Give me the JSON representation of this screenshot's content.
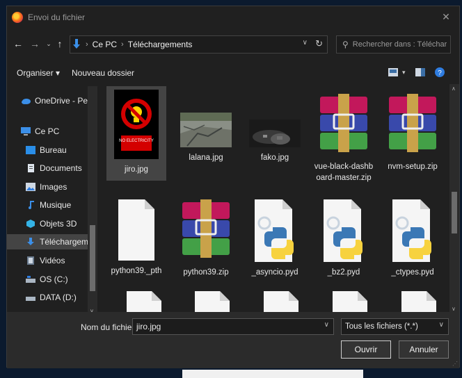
{
  "window": {
    "title": "Envoi du fichier",
    "close_glyph": "✕"
  },
  "nav": {
    "breadcrumbs": [
      "Ce PC",
      "Téléchargements"
    ],
    "search_placeholder": "Rechercher dans : Télécharg..."
  },
  "toolbar": {
    "organize": "Organiser ▾",
    "new_folder": "Nouveau dossier"
  },
  "sidebar": {
    "items": [
      {
        "label": "OneDrive - Persor",
        "icon": "cloud-icon"
      },
      {
        "label": "Ce PC",
        "icon": "computer-icon"
      },
      {
        "label": "Bureau",
        "icon": "desktop-icon"
      },
      {
        "label": "Documents",
        "icon": "documents-icon"
      },
      {
        "label": "Images",
        "icon": "pictures-icon"
      },
      {
        "label": "Musique",
        "icon": "music-icon"
      },
      {
        "label": "Objets 3D",
        "icon": "3d-objects-icon"
      },
      {
        "label": "Téléchargements",
        "icon": "downloads-icon",
        "selected": true
      },
      {
        "label": "Vidéos",
        "icon": "videos-icon"
      },
      {
        "label": "OS (C:)",
        "icon": "drive-icon"
      },
      {
        "label": "DATA (D:)",
        "icon": "drive-icon"
      }
    ]
  },
  "files": [
    {
      "name": "jiro.jpg",
      "type": "no-electricity-image",
      "selected": true,
      "sign_text": "NO ELECTRICITY"
    },
    {
      "name": "lalana.jpg",
      "type": "road-image"
    },
    {
      "name": "fako.jpg",
      "type": "trash-image"
    },
    {
      "name": "vue-black-dashboard-master.zip",
      "line1": "vue-black-dashb",
      "line2": "oard-master.zip",
      "type": "winrar-archive"
    },
    {
      "name": "nvm-setup.zip",
      "type": "winrar-archive"
    },
    {
      "name": "python39._pth",
      "type": "blank-file"
    },
    {
      "name": "python39.zip",
      "type": "winrar-archive"
    },
    {
      "name": "_asyncio.pyd",
      "type": "python-file"
    },
    {
      "name": "_bz2.pyd",
      "type": "python-file"
    },
    {
      "name": "_ctypes.pyd",
      "type": "python-file"
    }
  ],
  "footer": {
    "filename_label": "Nom du fichier :",
    "filename_value": "jiro.jpg",
    "filter": "Tous les fichiers (*.*)",
    "open": "Ouvrir",
    "cancel": "Annuler"
  }
}
